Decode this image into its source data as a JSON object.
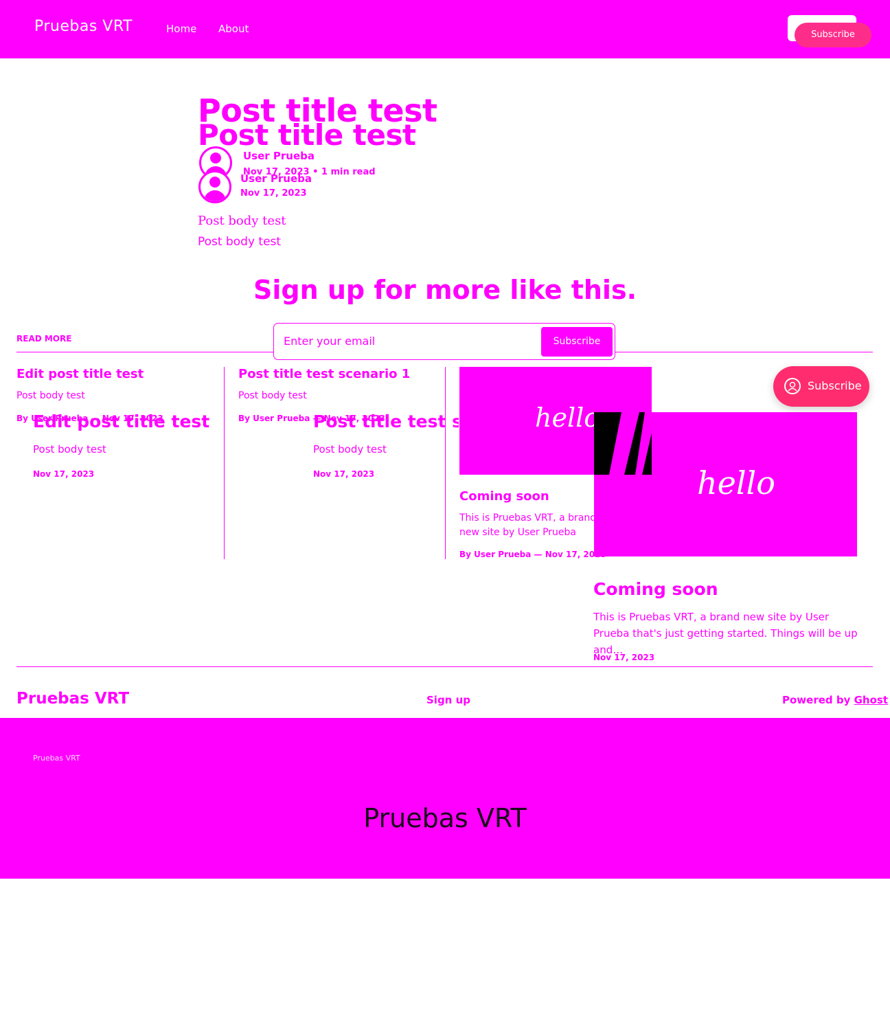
{
  "header": {
    "logo": "Pruebas VRT",
    "nav": [
      "Home",
      "About"
    ],
    "subscribe_label": "Subscribe"
  },
  "post": {
    "title_a": "Post title test",
    "title_b": "Post title test",
    "author_a": "User Prueba",
    "meta_a": "Nov 17, 2023 • 1 min read",
    "author_b": "User Prueba",
    "meta_b": "Nov 17, 2023",
    "body_a": "Post body test",
    "body_b": "Post body test"
  },
  "signup": {
    "title": "Sign up for more like this.",
    "placeholder": "Enter your email",
    "button": "Subscribe"
  },
  "read_more": {
    "label": "READ MORE",
    "cards": [
      {
        "title": "Edit post title test",
        "body": "Post body test",
        "meta": "By User Prueba — Nov 17, 2023"
      },
      {
        "title": "Post title test scenario 1",
        "body": "Post body test",
        "meta": "By User Prueba — Nov 17, 2023"
      },
      {
        "title": "Coming soon",
        "body": "This is Pruebas VRT, a brand new site by User Prueba that's just getting started.",
        "meta": "By User Prueba — Nov 17, 2023",
        "image_text": "hello"
      }
    ],
    "overlay_cards": [
      {
        "title": "Edit post title test",
        "body": "Post body test",
        "date": "Nov 17, 2023"
      },
      {
        "title": "Post title test scenario 1",
        "body": "Post body test",
        "date": "Nov 17, 2023"
      },
      {
        "title": "Coming soon",
        "body": "This is Pruebas VRT, a brand new site by User Prueba that's just getting started. Things will be up and…",
        "date": "Nov 17, 2023",
        "image_text": "hello"
      }
    ]
  },
  "portal": {
    "label": "Subscribe"
  },
  "footer": {
    "logo": "Pruebas VRT",
    "signup": "Sign up",
    "powered_prefix": "Powered by ",
    "powered_link": "Ghost"
  },
  "band": {
    "small": "Pruebas VRT",
    "big": "Pruebas VRT"
  },
  "colors": {
    "accent": "#ff00ff",
    "portal": "#ff2d6f",
    "band_text": "#1a0a1a"
  }
}
